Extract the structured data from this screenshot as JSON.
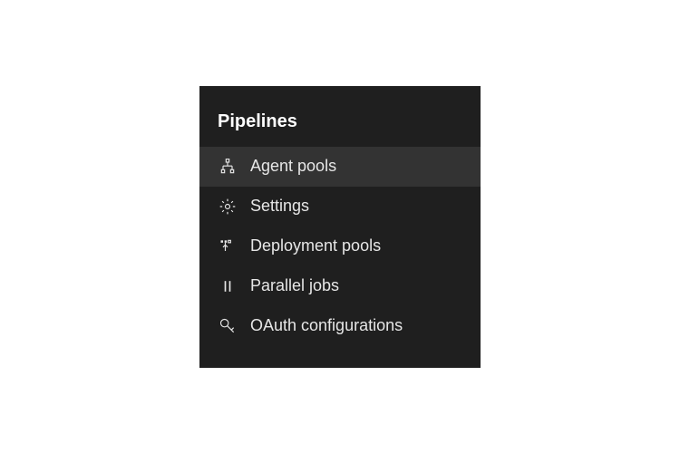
{
  "sidebar": {
    "title": "Pipelines",
    "items": [
      {
        "label": "Agent pools",
        "active": true
      },
      {
        "label": "Settings",
        "active": false
      },
      {
        "label": "Deployment pools",
        "active": false
      },
      {
        "label": "Parallel jobs",
        "active": false
      },
      {
        "label": "OAuth configurations",
        "active": false
      }
    ]
  }
}
